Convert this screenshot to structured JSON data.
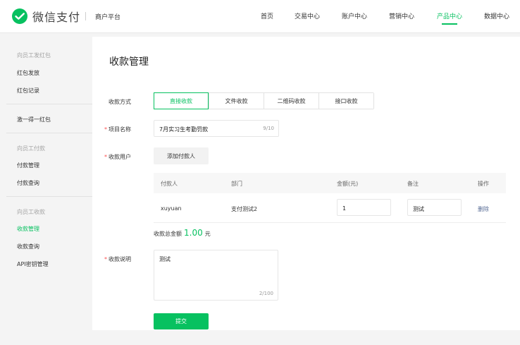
{
  "brand": {
    "logo_text": "微信支付",
    "platform": "商户平台",
    "accent": "#07c160"
  },
  "nav": {
    "items": [
      {
        "label": "首页"
      },
      {
        "label": "交易中心"
      },
      {
        "label": "账户中心"
      },
      {
        "label": "营销中心"
      },
      {
        "label": "产品中心",
        "active": true
      },
      {
        "label": "数据中心"
      }
    ]
  },
  "sidebar": {
    "groups": [
      {
        "title": "向员工发红包",
        "items": [
          "红包发放",
          "红包记录"
        ]
      },
      {
        "title": "",
        "items": [
          "激一得一红包"
        ]
      },
      {
        "title": "向员工付款",
        "items": [
          "付款管理",
          "付款查询"
        ]
      },
      {
        "title": "向员工收款",
        "items": [
          "收款管理",
          "收款查询",
          "API密钥管理"
        ]
      }
    ],
    "active_item": "收款管理"
  },
  "page": {
    "title": "收款管理"
  },
  "form": {
    "method_label": "收款方式",
    "method_tabs": [
      "直接收款",
      "文件收款",
      "二维码收款",
      "接口收款"
    ],
    "method_selected": "直接收款",
    "project_label": "项目名称",
    "project_value": "7月实习生考勤罚款",
    "project_count": "9/10",
    "payer_label": "收款用户",
    "add_payer_button": "添加付款人",
    "table": {
      "headers": [
        "付款人",
        "部门",
        "金额(元)",
        "备注",
        "操作"
      ],
      "rows": [
        {
          "payer": "xuyuan",
          "dept": "支付测试2",
          "amount": "1",
          "remark": "测试",
          "action": "删除"
        }
      ]
    },
    "total_prefix": "收款总金额",
    "total_amount": "1.00",
    "total_unit": "元",
    "note_label": "收款说明",
    "note_value": "测试",
    "note_count": "2/100",
    "submit_button": "提交"
  }
}
